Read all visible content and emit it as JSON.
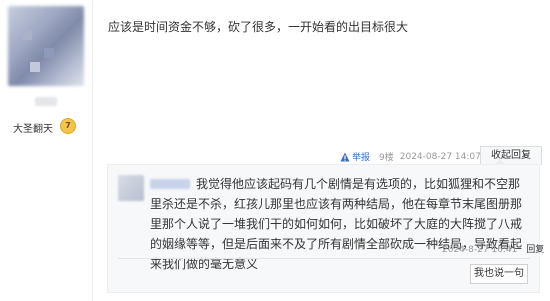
{
  "post": {
    "text": "应该是时间资金不够，砍了很多，一开始看的出目标很大",
    "report_label": "举报",
    "floor": "9楼",
    "time": "2024-08-27 14:07",
    "collapse_label": "收起回复"
  },
  "author": {
    "name": "大圣翻天",
    "level": "7"
  },
  "reply": {
    "text": "我觉得他应该起码有几个剧情是有选项的，比如狐狸和不空那里杀还是不杀，红孩儿那里也应该有两种结局，他在每章节末尾图册那里那个人说了一堆我们干的如何如何，比如破坏了大庭的大阵搅了八戒的姻缘等等，但是后面来不及了所有剧情全部砍成一种结局，导致看起来我们做的毫无意义",
    "time": "2024-8-27 16:41",
    "reply_link": "回复",
    "reply_button": "我也说一句"
  },
  "colors": {
    "link": "#3d6cc0",
    "panel_bg": "#f7f8fa",
    "badge": "#f3c44d"
  }
}
